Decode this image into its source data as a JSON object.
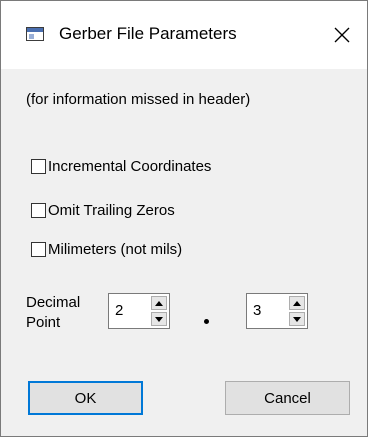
{
  "window": {
    "title": "Gerber File Parameters"
  },
  "info": "(for information missed in header)",
  "checkboxes": [
    {
      "label": "Incremental Coordinates",
      "checked": false
    },
    {
      "label": "Omit Trailing Zeros",
      "checked": false
    },
    {
      "label": "Milimeters (not mils)",
      "checked": false
    }
  ],
  "decimal_point": {
    "label_line1": "Decimal",
    "label_line2": "Point",
    "integer_digits": "2",
    "fraction_digits": "3"
  },
  "buttons": {
    "ok": "OK",
    "cancel": "Cancel"
  },
  "colors": {
    "focus_accent": "#0078d7",
    "dialog_bg": "#f0f0f0"
  }
}
